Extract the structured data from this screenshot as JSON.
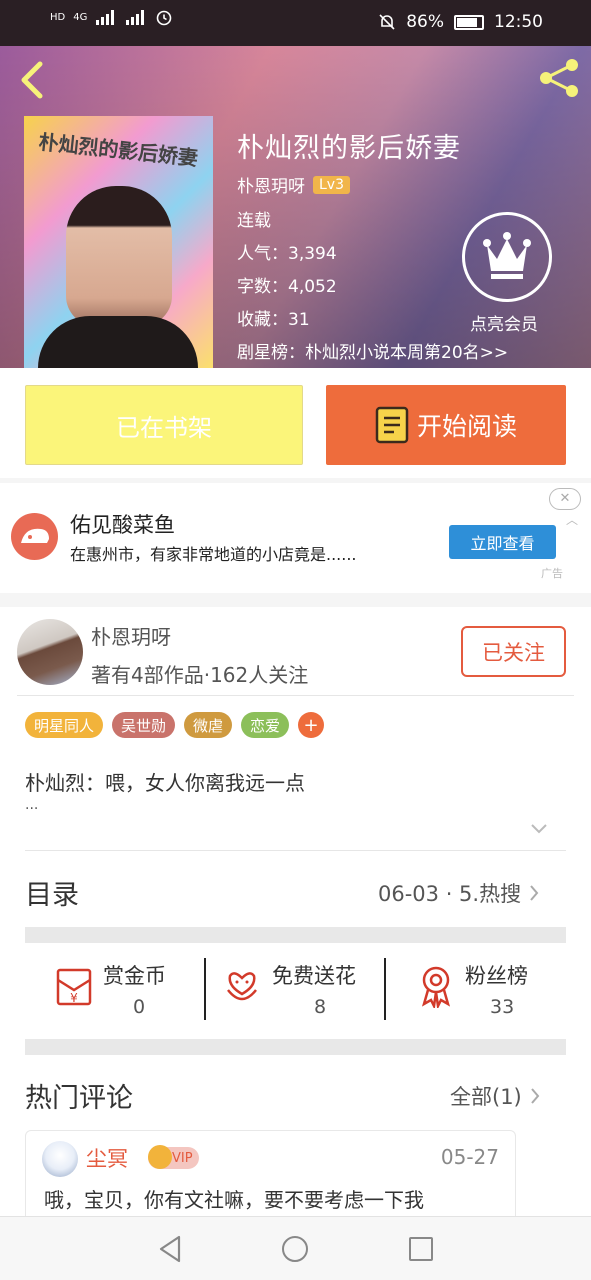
{
  "status_bar": {
    "network": "4G",
    "battery": "86%",
    "time": "12:50"
  },
  "header": {
    "cover_title": "朴灿烈的影后娇妻",
    "title": "朴灿烈的影后娇妻",
    "author": "朴恩玥呀",
    "author_level": "Lv3",
    "status": "连载",
    "popularity": "人气：3,394",
    "word_count": "字数：4,052",
    "favorites": "收藏：31",
    "ranking": "剧星榜：朴灿烈小说本周第20名>>",
    "vip_label": "点亮会员",
    "icons": {
      "back": "back-arrow-icon",
      "share": "share-icon",
      "vip": "crown-icon"
    }
  },
  "actions": {
    "shelf_label": "已在书架",
    "read_label": "开始阅读"
  },
  "ad": {
    "title": "佑见酸菜鱼",
    "desc": "在惠州市，有家非常地道的小店竟是......",
    "button": "立即查看",
    "tag": "广告",
    "close": "✕"
  },
  "author_card": {
    "name": "朴恩玥呀",
    "subtitle": "著有4部作品·162人关注",
    "follow_label": "已关注"
  },
  "tags": [
    {
      "label": "明星同人",
      "color": "#f2b33b"
    },
    {
      "label": "吴世勋",
      "color": "#c9736b"
    },
    {
      "label": "微虐",
      "color": "#cf9a3f"
    },
    {
      "label": "恋爱",
      "color": "#8cbf5a"
    }
  ],
  "tag_plus": "+",
  "intro": {
    "text": "朴灿烈：喂，女人你离我远一点",
    "more": "..."
  },
  "toc": {
    "label": "目录",
    "latest": "06-03 · 5.热搜"
  },
  "stats": [
    {
      "title": "赏金币",
      "value": "0",
      "icon": "red-envelope-icon"
    },
    {
      "title": "免费送花",
      "value": "8",
      "icon": "flower-icon"
    },
    {
      "title": "粉丝榜",
      "value": "33",
      "icon": "medal-icon"
    }
  ],
  "comments_section": {
    "label": "热门评论",
    "all_label": "全部(1)"
  },
  "comment": {
    "user": "尘冥",
    "vip": "VIP",
    "date": "05-27",
    "text": "哦，宝贝，你有文社嘛，要不要考虑一下我"
  },
  "colors": {
    "accent": "#ee6c3c",
    "follow": "#e45b3f",
    "shelf_button": "#fbf57a",
    "ad_button": "#2e8fd8"
  }
}
